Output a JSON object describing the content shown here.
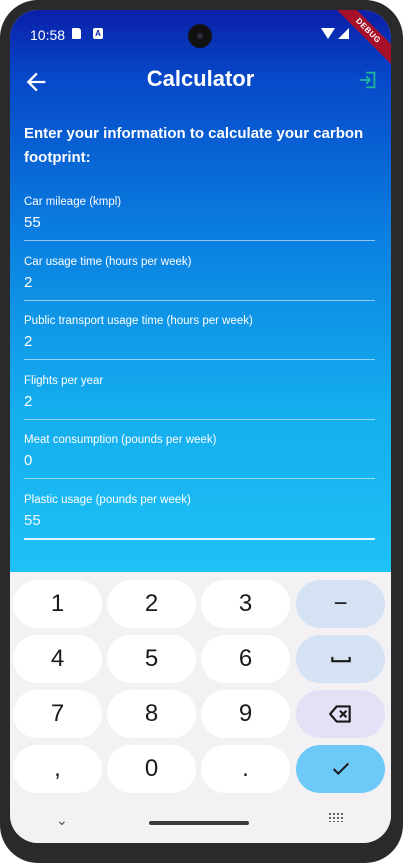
{
  "status_bar": {
    "time": "10:58",
    "badge_a": "A"
  },
  "debug_label": "DEBUG",
  "app_bar": {
    "title": "Calculator"
  },
  "form": {
    "heading": "Enter your information to calculate your carbon footprint:",
    "fields": [
      {
        "label": "Car mileage (kmpl)",
        "value": "55"
      },
      {
        "label": "Car usage time (hours per week)",
        "value": "2"
      },
      {
        "label": "Public transport usage time (hours per week)",
        "value": "2"
      },
      {
        "label": "Flights per year",
        "value": "2"
      },
      {
        "label": "Meat consumption (pounds per week)",
        "value": "0"
      },
      {
        "label": "Plastic usage (pounds per week)",
        "value": "55"
      }
    ]
  },
  "keyboard": {
    "keys": [
      "1",
      "2",
      "3",
      "−",
      "4",
      "5",
      "6",
      "⎵",
      "7",
      "8",
      "9",
      "⌫",
      ",",
      "0",
      ".",
      "✓"
    ]
  },
  "colors": {
    "gradient_top": "#0a1fa8",
    "gradient_bottom": "#1ec2f5",
    "done_key": "#6dc9f7",
    "fn_key": "#d4e2f3",
    "delete_key": "#e6e0f7",
    "logout_icon": "#1fb4a0"
  }
}
